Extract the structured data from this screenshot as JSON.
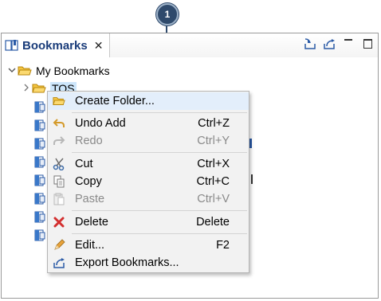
{
  "callout": {
    "number": "1"
  },
  "view": {
    "title": "Bookmarks",
    "close": "✕"
  },
  "tree": {
    "root_label": "My Bookmarks",
    "selected_folder": "TOS",
    "bookmark_count": 8
  },
  "menu": {
    "items": [
      {
        "label": "Create Folder...",
        "shortcut": "",
        "enabled": true,
        "icon": "folder-open-icon"
      },
      {
        "label": "Undo Add",
        "shortcut": "Ctrl+Z",
        "enabled": true,
        "icon": "undo-icon"
      },
      {
        "label": "Redo",
        "shortcut": "Ctrl+Y",
        "enabled": false,
        "icon": "redo-icon"
      },
      {
        "label": "Cut",
        "shortcut": "Ctrl+X",
        "enabled": true,
        "icon": "scissors-icon"
      },
      {
        "label": "Copy",
        "shortcut": "Ctrl+C",
        "enabled": true,
        "icon": "copy-icon"
      },
      {
        "label": "Paste",
        "shortcut": "Ctrl+V",
        "enabled": false,
        "icon": "paste-icon"
      },
      {
        "label": "Delete",
        "shortcut": "Delete",
        "enabled": true,
        "icon": "delete-icon"
      },
      {
        "label": "Edit...",
        "shortcut": "F2",
        "enabled": true,
        "icon": "pencil-icon"
      },
      {
        "label": "Export Bookmarks...",
        "shortcut": "",
        "enabled": true,
        "icon": "export-icon"
      }
    ]
  },
  "colors": {
    "accent": "#2f4a6c",
    "title_text": "#1a3c7a",
    "selection": "#cde6fb",
    "menu_bg": "#f2f2f2",
    "delete_red": "#d32f2f"
  }
}
